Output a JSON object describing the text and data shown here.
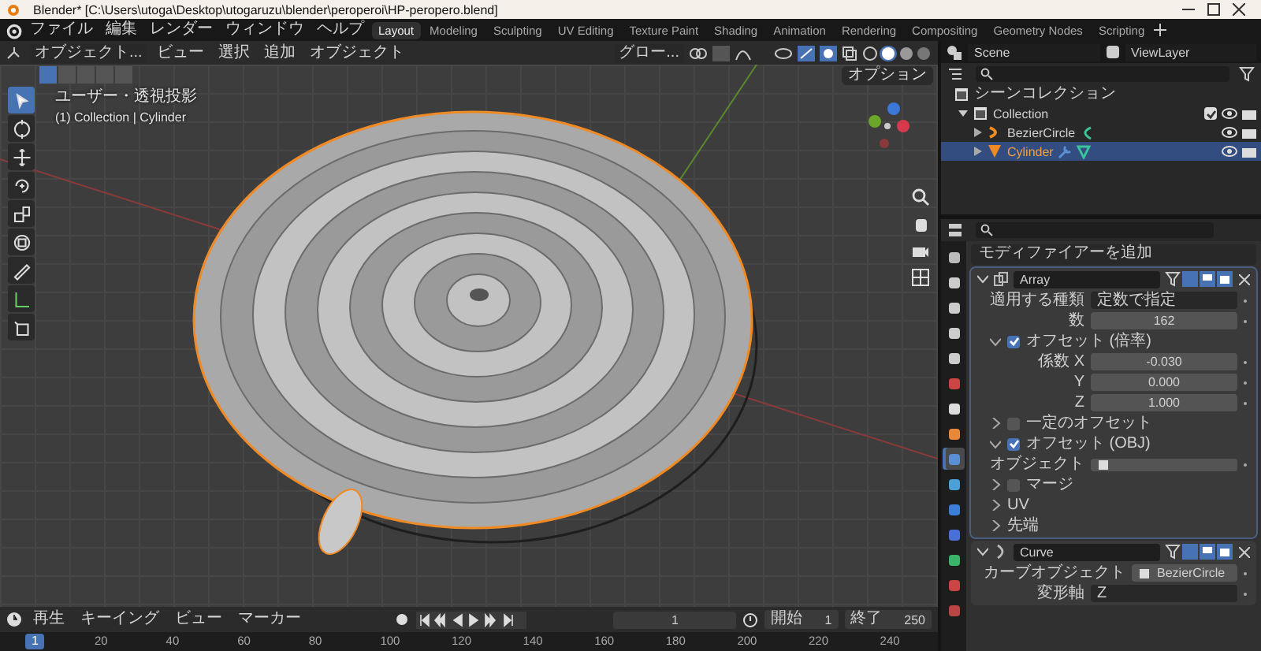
{
  "window": {
    "title": "Blender* [C:\\Users\\utoga\\Desktop\\utogaruzu\\blender\\peroperoi\\HP-peropero.blend]"
  },
  "menu": [
    "ファイル",
    "編集",
    "レンダー",
    "ウィンドウ",
    "ヘルプ"
  ],
  "workspaces": [
    {
      "label": "Layout",
      "selected": true
    },
    {
      "label": "Modeling",
      "selected": false
    },
    {
      "label": "Sculpting",
      "selected": false
    },
    {
      "label": "UV Editing",
      "selected": false
    },
    {
      "label": "Texture Paint",
      "selected": false
    },
    {
      "label": "Shading",
      "selected": false
    },
    {
      "label": "Animation",
      "selected": false
    },
    {
      "label": "Rendering",
      "selected": false
    },
    {
      "label": "Compositing",
      "selected": false
    },
    {
      "label": "Geometry Nodes",
      "selected": false
    },
    {
      "label": "Scripting",
      "selected": false
    }
  ],
  "scene": {
    "scene": "Scene",
    "view_layer": "ViewLayer"
  },
  "viewport": {
    "mode": "オブジェクト...",
    "menus": [
      "ビュー",
      "選択",
      "追加",
      "オブジェクト"
    ],
    "orientation": "グロー...",
    "options": "オプション",
    "view_name": "ユーザー・透視投影",
    "context": "(1) Collection | Cylinder",
    "tools": [
      {
        "kind": "select",
        "selected": true
      },
      {
        "kind": "cursor",
        "selected": false
      },
      {
        "kind": "move",
        "selected": false
      },
      {
        "kind": "rotate",
        "selected": false
      },
      {
        "kind": "scale",
        "selected": false
      },
      {
        "kind": "transform",
        "selected": false
      },
      {
        "kind": "annotate",
        "selected": false
      },
      {
        "kind": "measure",
        "selected": false
      },
      {
        "kind": "add-cube",
        "selected": false
      }
    ]
  },
  "outliner": {
    "root": "シーンコレクション",
    "items": [
      {
        "label": "Collection",
        "kind": "collection",
        "checked": true,
        "selected": false,
        "children": [
          {
            "label": "BezierCircle",
            "kind": "curve",
            "selected": false
          },
          {
            "label": "Cylinder",
            "kind": "mesh",
            "selected": true
          }
        ]
      }
    ]
  },
  "properties": {
    "add_modifier": "モディファイアーを追加",
    "tabs": [
      {
        "kind": "tool",
        "selected": false
      },
      {
        "kind": "render",
        "selected": false
      },
      {
        "kind": "output",
        "selected": false
      },
      {
        "kind": "view",
        "selected": false
      },
      {
        "kind": "scene",
        "selected": false
      },
      {
        "kind": "world",
        "selected": false
      },
      {
        "kind": "collection",
        "selected": false
      },
      {
        "kind": "object",
        "selected": false
      },
      {
        "kind": "modifier",
        "selected": true
      },
      {
        "kind": "particles",
        "selected": false
      },
      {
        "kind": "physics",
        "selected": false
      },
      {
        "kind": "constraints",
        "selected": false
      },
      {
        "kind": "data",
        "selected": false
      },
      {
        "kind": "material",
        "selected": false
      },
      {
        "kind": "texture",
        "selected": false
      }
    ],
    "modifiers": [
      {
        "name": "Array",
        "kind": "array",
        "rows": [
          {
            "kind": "select",
            "label": "適用する種類",
            "value": "定数で指定"
          },
          {
            "kind": "number",
            "label": "数",
            "value": "162"
          },
          {
            "kind": "subpanel",
            "label": "オフセット (倍率)",
            "expanded": true,
            "checked": true
          },
          {
            "kind": "number",
            "label": "係数 X",
            "value": "-0.030"
          },
          {
            "kind": "number",
            "label": "Y",
            "value": "0.000"
          },
          {
            "kind": "number",
            "label": "Z",
            "value": "1.000"
          },
          {
            "kind": "subpanel",
            "label": "一定のオフセット",
            "expanded": false,
            "checked": false
          },
          {
            "kind": "subpanel",
            "label": "オフセット (OBJ)",
            "expanded": true,
            "checked": true
          },
          {
            "kind": "object",
            "label": "オブジェクト"
          },
          {
            "kind": "subpanel",
            "label": "マージ",
            "expanded": false,
            "checked": false
          },
          {
            "kind": "section",
            "label": "UV",
            "expanded": false
          },
          {
            "kind": "section",
            "label": "先端",
            "expanded": false
          }
        ]
      },
      {
        "name": "Curve",
        "kind": "curve",
        "rows": [
          {
            "kind": "object",
            "label": "カーブオブジェクト",
            "value": "BezierCircle"
          },
          {
            "kind": "select",
            "label": "変形軸",
            "value": "Z"
          }
        ]
      }
    ]
  },
  "timeline": {
    "menus": [
      "再生",
      "キーイング",
      "ビュー",
      "マーカー"
    ],
    "current": "1",
    "start_label": "開始",
    "start": "1",
    "end_label": "終了",
    "end": "250",
    "frame_badge": "1",
    "ticks": [
      "20",
      "40",
      "60",
      "80",
      "100",
      "120",
      "140",
      "160",
      "180",
      "200",
      "220",
      "240"
    ]
  }
}
